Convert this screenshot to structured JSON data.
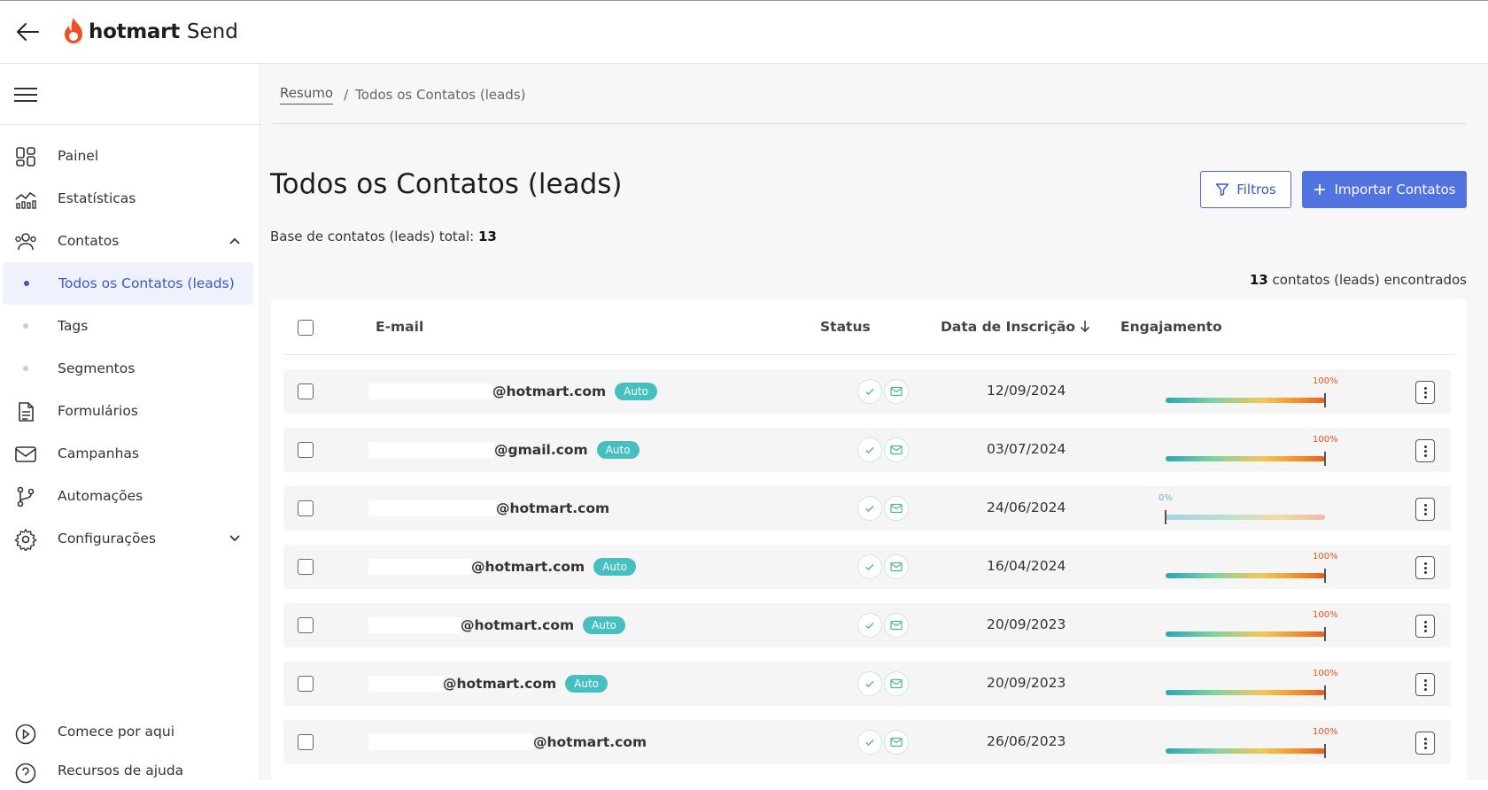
{
  "header": {
    "back_icon": "arrow-left-icon",
    "logo_brand": "hotmart",
    "logo_product": "Send",
    "brand_color": "#f04e23"
  },
  "sidebar": {
    "menu_icon": "hamburger-icon",
    "items": [
      {
        "label": "Painel",
        "icon": "dashboard-icon"
      },
      {
        "label": "Estatísticas",
        "icon": "stats-icon"
      },
      {
        "label": "Contatos",
        "icon": "users-icon",
        "expanded": true
      },
      {
        "label": "Todos os Contatos (leads)",
        "active": true
      },
      {
        "label": "Tags"
      },
      {
        "label": "Segmentos"
      },
      {
        "label": "Formulários",
        "icon": "document-icon"
      },
      {
        "label": "Campanhas",
        "icon": "mail-icon"
      },
      {
        "label": "Automações",
        "icon": "branch-icon"
      },
      {
        "label": "Configurações",
        "icon": "gear-icon"
      }
    ],
    "bottom_items": [
      {
        "label": "Comece por aqui",
        "icon": "play-circle-icon"
      },
      {
        "label": "Recursos de ajuda",
        "icon": "help-circle-icon"
      }
    ]
  },
  "breadcrumb": {
    "root": "Resumo",
    "separator": "/",
    "current": "Todos os Contatos (leads)"
  },
  "page": {
    "title": "Todos os Contatos (leads)",
    "total_label": "Base de contatos (leads) total:",
    "total_value": "13",
    "filters_label": "Filtros",
    "import_label": "Importar Contatos",
    "found_count": "13",
    "found_label": "contatos (leads) encontrados",
    "accent_color": "#5073e0"
  },
  "table": {
    "headers": {
      "email": "E-mail",
      "status": "Status",
      "date": "Data de Inscrição",
      "engagement": "Engajamento"
    },
    "rows": [
      {
        "email_suffix": "@hotmart.com",
        "auto": "Auto",
        "date": "12/09/2024",
        "engagement_pct": "100%",
        "engagement": 1.0
      },
      {
        "email_suffix": "@gmail.com",
        "auto": "Auto",
        "date": "03/07/2024",
        "engagement_pct": "100%",
        "engagement": 1.0
      },
      {
        "email_suffix": "@hotmart.com",
        "auto": "",
        "date": "24/06/2024",
        "engagement_pct": "0%",
        "engagement": 0.0
      },
      {
        "email_suffix": "@hotmart.com",
        "auto": "Auto",
        "date": "16/04/2024",
        "engagement_pct": "100%",
        "engagement": 1.0
      },
      {
        "email_suffix": "@hotmart.com",
        "auto": "Auto",
        "date": "20/09/2023",
        "engagement_pct": "100%",
        "engagement": 1.0
      },
      {
        "email_suffix": "@hotmart.com",
        "auto": "Auto",
        "date": "20/09/2023",
        "engagement_pct": "100%",
        "engagement": 1.0
      },
      {
        "email_suffix": "@hotmart.com",
        "auto": "",
        "date": "26/06/2023",
        "engagement_pct": "100%",
        "engagement": 1.0
      }
    ]
  }
}
